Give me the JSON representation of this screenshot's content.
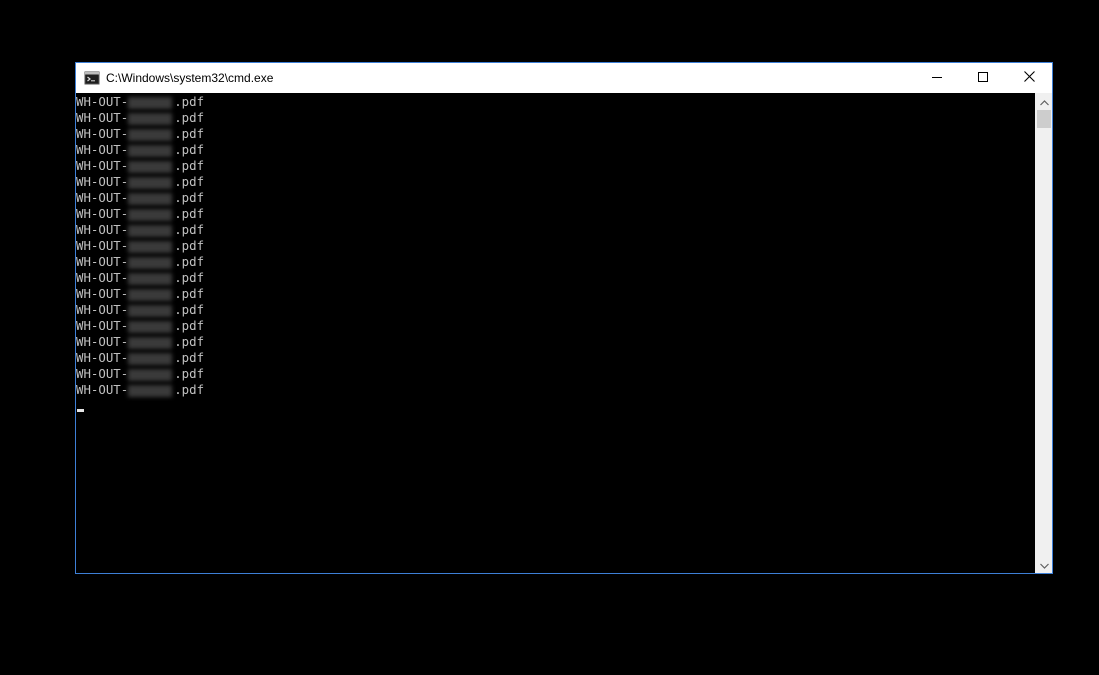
{
  "window": {
    "title": "C:\\Windows\\system32\\cmd.exe",
    "icons": {
      "app": "cmd-icon",
      "minimize": "minimize-icon",
      "maximize": "maximize-icon",
      "close": "close-icon"
    }
  },
  "console": {
    "lines": [
      {
        "prefix": "WH-OUT-",
        "suffix": ".pdf"
      },
      {
        "prefix": "WH-OUT-",
        "suffix": ".pdf"
      },
      {
        "prefix": "WH-OUT-",
        "suffix": ".pdf"
      },
      {
        "prefix": "WH-OUT-",
        "suffix": ".pdf"
      },
      {
        "prefix": "WH-OUT-",
        "suffix": ".pdf"
      },
      {
        "prefix": "WH-OUT-",
        "suffix": ".pdf"
      },
      {
        "prefix": "WH-OUT-",
        "suffix": ".pdf"
      },
      {
        "prefix": "WH-OUT-",
        "suffix": ".pdf"
      },
      {
        "prefix": "WH-OUT-",
        "suffix": ".pdf"
      },
      {
        "prefix": "WH-OUT-",
        "suffix": ".pdf"
      },
      {
        "prefix": "WH-OUT-",
        "suffix": ".pdf"
      },
      {
        "prefix": "WH-OUT-",
        "suffix": ".pdf"
      },
      {
        "prefix": "WH-OUT-",
        "suffix": ".pdf"
      },
      {
        "prefix": "WH-OUT-",
        "suffix": ".pdf"
      },
      {
        "prefix": "WH-OUT-",
        "suffix": ".pdf"
      },
      {
        "prefix": "WH-OUT-",
        "suffix": ".pdf"
      },
      {
        "prefix": "WH-OUT-",
        "suffix": ".pdf"
      },
      {
        "prefix": "WH-OUT-",
        "suffix": ".pdf"
      },
      {
        "prefix": "WH-OUT-",
        "suffix": ".pdf"
      }
    ]
  },
  "colors": {
    "accent_border": "#3d7fd6",
    "console_bg": "#000000",
    "console_text": "#c0c0c0"
  }
}
